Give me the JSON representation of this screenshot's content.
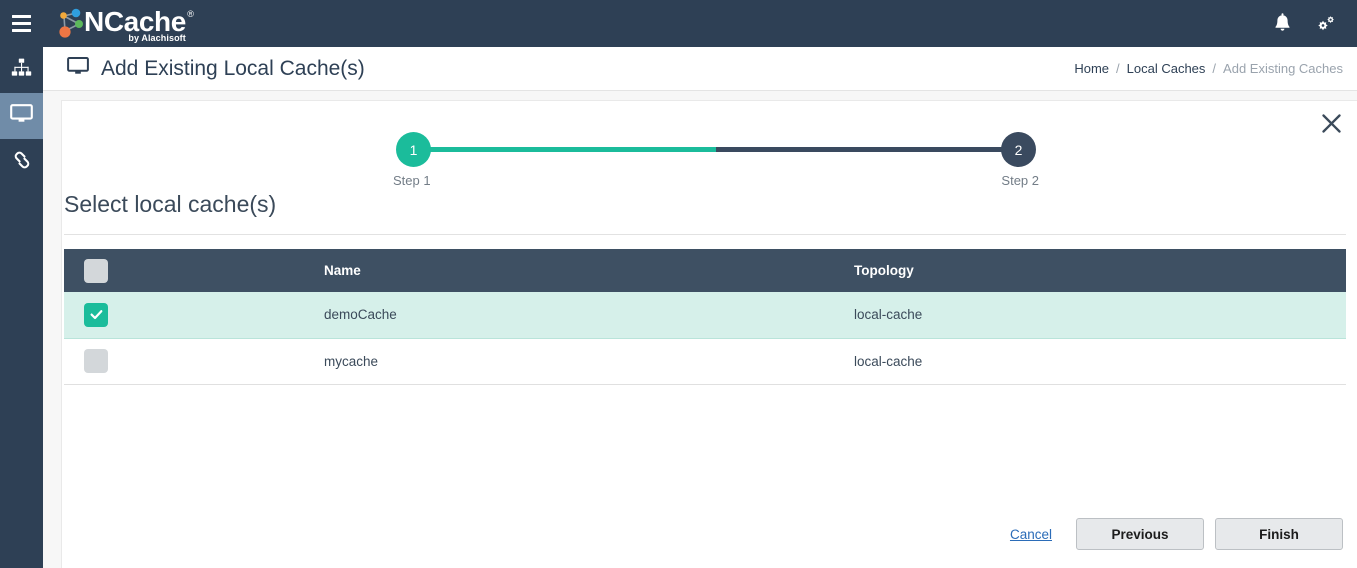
{
  "topbar": {
    "menu_icon": "hamburger-menu-icon",
    "brand_name": "NCache",
    "brand_registered": "®",
    "brand_tagline": "by Alachisoft",
    "notification_icon": "bell-icon",
    "settings_icon": "gears-icon"
  },
  "sidebar": {
    "items": [
      {
        "name": "cluster-caches",
        "icon": "sitemap-icon",
        "active": false
      },
      {
        "name": "local-caches",
        "icon": "monitor-icon",
        "active": true
      },
      {
        "name": "linked-caches",
        "icon": "link-icon",
        "active": false
      }
    ]
  },
  "pagehead": {
    "icon": "monitor-icon",
    "title": "Add Existing Local Cache(s)",
    "breadcrumb": [
      {
        "label": "Home",
        "current": false
      },
      {
        "label": "Local Caches",
        "current": false
      },
      {
        "label": "Add Existing Caches",
        "current": true
      }
    ],
    "separator": "/"
  },
  "card": {
    "close_icon": "close-x-icon",
    "stepper": {
      "steps": [
        {
          "number": "1",
          "label": "Step 1",
          "state": "active"
        },
        {
          "number": "2",
          "label": "Step 2",
          "state": "pending"
        }
      ]
    },
    "section_title": "Select local cache(s)",
    "table": {
      "columns": [
        {
          "key": "select",
          "label": ""
        },
        {
          "key": "name",
          "label": "Name"
        },
        {
          "key": "topology",
          "label": "Topology"
        }
      ],
      "header_checkbox_checked": false,
      "rows": [
        {
          "checked": true,
          "name": "demoCache",
          "topology": "local-cache"
        },
        {
          "checked": false,
          "name": "mycache",
          "topology": "local-cache"
        }
      ]
    },
    "footer": {
      "cancel_label": "Cancel",
      "previous_label": "Previous",
      "finish_label": "Finish"
    }
  },
  "colors": {
    "navy": "#2e4055",
    "teal": "#1bbc9b",
    "table_header": "#3e5063",
    "row_selected": "#d6f0ea",
    "step_pending": "#3a4a5f",
    "link_blue": "#2b6cb8"
  }
}
